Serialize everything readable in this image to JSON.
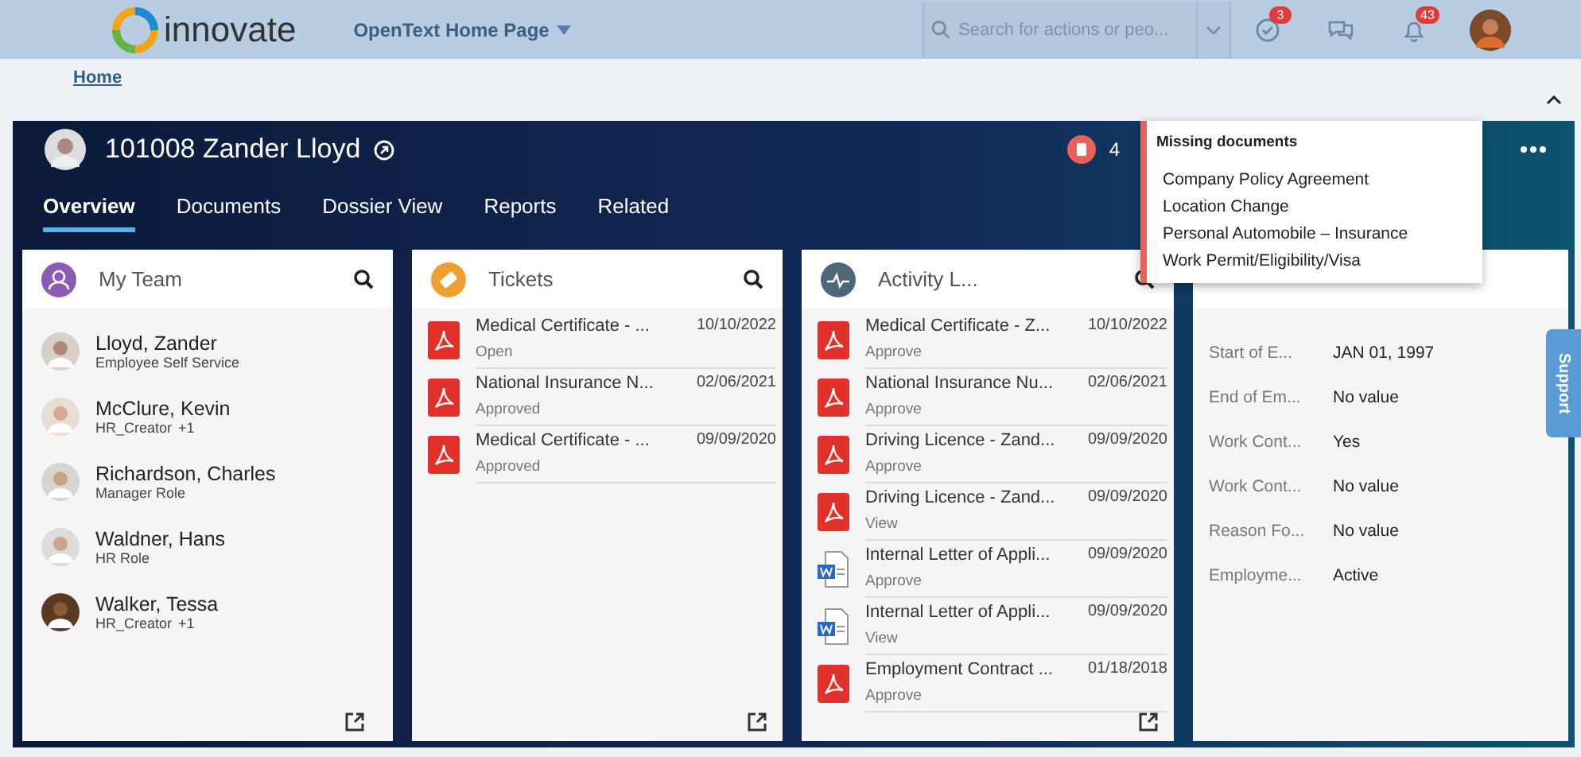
{
  "topbar": {
    "logo_text": "innovate",
    "home_menu": "OpenText Home Page",
    "search": {
      "placeholder": "Search for actions or peo..."
    },
    "tasks_badge": "3",
    "notifications_badge": "43"
  },
  "breadcrumb": "Home",
  "profile": {
    "title": "101008 Zander Lloyd",
    "missing_count": "4",
    "tabs": [
      {
        "label": "Overview",
        "selected": true
      },
      {
        "label": "Documents",
        "selected": false
      },
      {
        "label": "Dossier View",
        "selected": false
      },
      {
        "label": "Reports",
        "selected": false
      },
      {
        "label": "Related",
        "selected": false
      }
    ]
  },
  "cards": [
    {
      "kind": "team",
      "title": "My Team",
      "members": [
        {
          "name": "Lloyd, Zander",
          "role": "Employee Self Service"
        },
        {
          "name": "McClure, Kevin",
          "role": "HR_Creator",
          "extra": "+1"
        },
        {
          "name": "Richardson, Charles",
          "role": "Manager Role"
        },
        {
          "name": "Waldner, Hans",
          "role": "HR Role"
        },
        {
          "name": "Walker, Tessa",
          "role": "HR_Creator",
          "extra": "+1"
        }
      ]
    },
    {
      "kind": "docs",
      "title": "Tickets",
      "items": [
        {
          "kind": "pdf",
          "title": "Medical Certificate - ...",
          "date": "10/10/2022",
          "status": "Open"
        },
        {
          "kind": "pdf",
          "title": "National Insurance N...",
          "date": "02/06/2021",
          "status": "Approved"
        },
        {
          "kind": "pdf",
          "title": "Medical Certificate - ...",
          "date": "09/09/2020",
          "status": "Approved"
        }
      ]
    },
    {
      "kind": "docs",
      "title": "Activity L...",
      "items": [
        {
          "kind": "pdf",
          "title": "Medical Certificate - Z...",
          "date": "10/10/2022",
          "status": "Approve"
        },
        {
          "kind": "pdf",
          "title": "National Insurance Nu...",
          "date": "02/06/2021",
          "status": "Approve"
        },
        {
          "kind": "pdf",
          "title": "Driving Licence - Zand...",
          "date": "09/09/2020",
          "status": "Approve"
        },
        {
          "kind": "pdf",
          "title": "Driving Licence - Zand...",
          "date": "09/09/2020",
          "status": "View"
        },
        {
          "kind": "word",
          "title": "Internal Letter of Appli...",
          "date": "09/09/2020",
          "status": "Approve"
        },
        {
          "kind": "word",
          "title": "Internal Letter of Appli...",
          "date": "09/09/2020",
          "status": "View"
        },
        {
          "kind": "pdf",
          "title": "Employment Contract ...",
          "date": "01/18/2018",
          "status": "Approve"
        }
      ]
    },
    {
      "kind": "fields",
      "fields": [
        {
          "label": "Start of E...",
          "value": "JAN 01, 1997"
        },
        {
          "label": "End of Em...",
          "value": "No value"
        },
        {
          "label": "Work Cont...",
          "value": "Yes"
        },
        {
          "label": "Work Cont...",
          "value": "No value"
        },
        {
          "label": "Reason Fo...",
          "value": "No value"
        },
        {
          "label": "Employme...",
          "value": "Active"
        }
      ]
    }
  ],
  "missing_popover": {
    "title": "Missing documents",
    "items": [
      "Company Policy Agreement",
      "Location Change",
      "Personal Automobile – Insurance",
      "Work Permit/Eligibility/Visa"
    ]
  },
  "support_tab": "Support"
}
